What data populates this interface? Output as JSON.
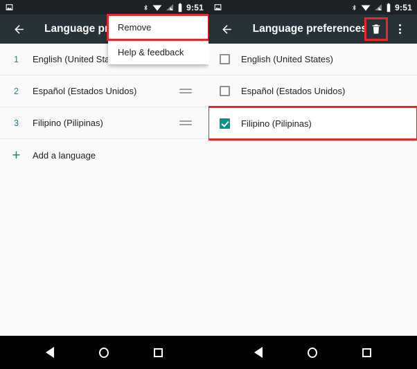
{
  "status_bar": {
    "notification_icon": "image-icon",
    "icons": [
      "bluetooth-icon",
      "wifi-icon",
      "cell-signal-icon",
      "battery-icon"
    ],
    "time": "9:51"
  },
  "left_panel": {
    "appbar": {
      "back_icon": "back-arrow-icon",
      "title": "Language prefe"
    },
    "menu": {
      "items": [
        {
          "label": "Remove",
          "highlighted": true
        },
        {
          "label": "Help & feedback",
          "highlighted": false
        }
      ]
    },
    "list": {
      "items": [
        {
          "index": "1",
          "label": "English (United States)",
          "drag_handle": false
        },
        {
          "index": "2",
          "label": "Español (Estados Unidos)",
          "drag_handle": true
        },
        {
          "index": "3",
          "label": "Filipino (Pilipinas)",
          "drag_handle": true
        }
      ],
      "add_row": {
        "icon": "plus-icon",
        "label": "Add a language"
      }
    }
  },
  "right_panel": {
    "appbar": {
      "back_icon": "back-arrow-icon",
      "title": "Language preferences",
      "delete_icon": "trash-icon",
      "overflow_icon": "overflow-menu-icon",
      "delete_highlighted": true
    },
    "list": {
      "items": [
        {
          "label": "English (United States)",
          "checked": false,
          "highlighted": false
        },
        {
          "label": "Español (Estados Unidos)",
          "checked": false,
          "highlighted": false
        },
        {
          "label": "Filipino (Pilipinas)",
          "checked": true,
          "highlighted": true
        }
      ]
    }
  },
  "nav_bar": {
    "back": "nav-back-icon",
    "home": "nav-home-icon",
    "recents": "nav-recents-icon"
  },
  "colors": {
    "appbar": "#263238",
    "statusbar": "#1c2125",
    "accent": "#009688",
    "highlight": "#e8262b",
    "background": "#fafafa"
  }
}
